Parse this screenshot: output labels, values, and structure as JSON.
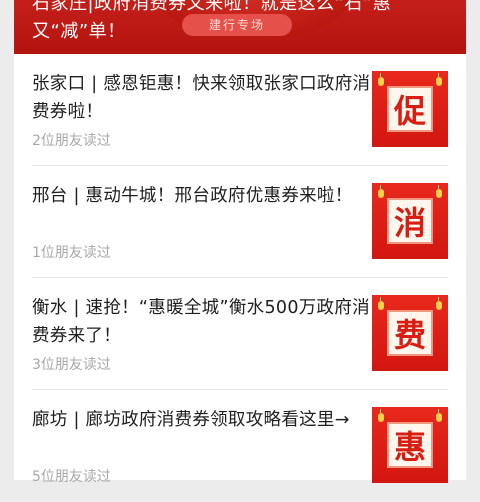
{
  "banner": {
    "title": "石家庄|政府消费券又来啦！就是这么“石”惠又“减”单！",
    "tag": "建行专场"
  },
  "articles": [
    {
      "title": "张家口 | 感恩钜惠！快来领取张家口政府消费券啦！",
      "readers": "2位朋友读过",
      "thumb_char": "促"
    },
    {
      "title": "邢台 | 惠动牛城！邢台政府优惠券来啦！",
      "readers": "1位朋友读过",
      "thumb_char": "消"
    },
    {
      "title": "衡水 | 速抢！“惠暖全城”衡水500万政府消费券来了！",
      "readers": "3位朋友读过",
      "thumb_char": "费"
    },
    {
      "title": "廊坊 | 廊坊政府消费券领取攻略看这里→",
      "readers": "5位朋友读过",
      "thumb_char": "惠"
    }
  ],
  "colors": {
    "accent": "#d11710",
    "meta_text": "#a8a8a8"
  }
}
